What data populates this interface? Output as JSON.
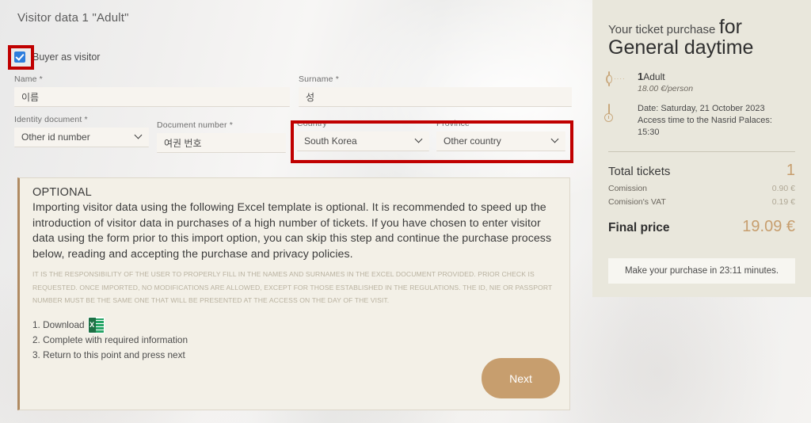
{
  "page": {
    "title": "Visitor data 1 \"Adult\""
  },
  "form": {
    "buyer_as_visitor": {
      "label": "Buyer as visitor",
      "checked": true
    },
    "fields": [
      {
        "key": "name",
        "label": "Name *",
        "value": "이름",
        "type": "text"
      },
      {
        "key": "surname",
        "label": "Surname *",
        "value": "성",
        "type": "text"
      },
      {
        "key": "id_type",
        "label": "Identity document *",
        "value": "Other id number",
        "type": "select"
      },
      {
        "key": "doc_num",
        "label": "Document number *",
        "value": "여권 번호",
        "type": "text"
      },
      {
        "key": "country",
        "label": "Country *",
        "value": "South Korea",
        "type": "select"
      },
      {
        "key": "province",
        "label": "Province *",
        "value": "Other country",
        "type": "select"
      }
    ]
  },
  "optional": {
    "heading": "OPTIONAL",
    "body": "Importing visitor data using the following Excel template is optional. It is recommended to speed up the introduction of visitor data in purchases of a high number of tickets. If you have chosen to enter visitor data using the form prior to this import option, you can skip this step and continue the purchase process below, reading and accepting the purchase and privacy policies.",
    "fine_print": "IT IS THE RESPONSIBILITY OF THE USER TO PROPERLY FILL IN THE NAMES AND SURNAMES IN THE EXCEL DOCUMENT PROVIDED. PRIOR CHECK IS REQUESTED. ONCE IMPORTED, NO MODIFICATIONS ARE ALLOWED, EXCEPT FOR THOSE ESTABLISHED IN THE REGULATIONS. THE ID, NIE OR PASSPORT NUMBER MUST BE THE SAME ONE THAT WILL BE PRESENTED AT THE ACCESS ON THE DAY OF THE VISIT.",
    "steps": [
      "1. Download",
      "2. Complete with required information",
      "3. Return to this point and press next"
    ],
    "excel_icon_letter": "X",
    "next_label": "Next"
  },
  "sidebar": {
    "headline_small": "Your ticket purchase",
    "headline_for": "for",
    "headline_big": "General daytime",
    "ticket_qty": "1",
    "ticket_type": "Adult",
    "price_per_person": "18.00 €/person",
    "date_line": "Date: Saturday, 21 October 2023",
    "access_line": "Access time to the Nasrid Palaces: 15:30",
    "total_tickets_label": "Total tickets",
    "total_tickets_value": "1",
    "commission_label": "Comission",
    "commission_value": "0.90 €",
    "commission_vat_label": "Comision's VAT",
    "commission_vat_value": "0.19 €",
    "final_price_label": "Final price",
    "final_price_value": "19.09 €",
    "timer_text": "Make your purchase in 23:11 minutes."
  },
  "annotations": {
    "color": "#c00000",
    "boxes": [
      "checkbox-highlight",
      "country-province-highlight"
    ]
  }
}
